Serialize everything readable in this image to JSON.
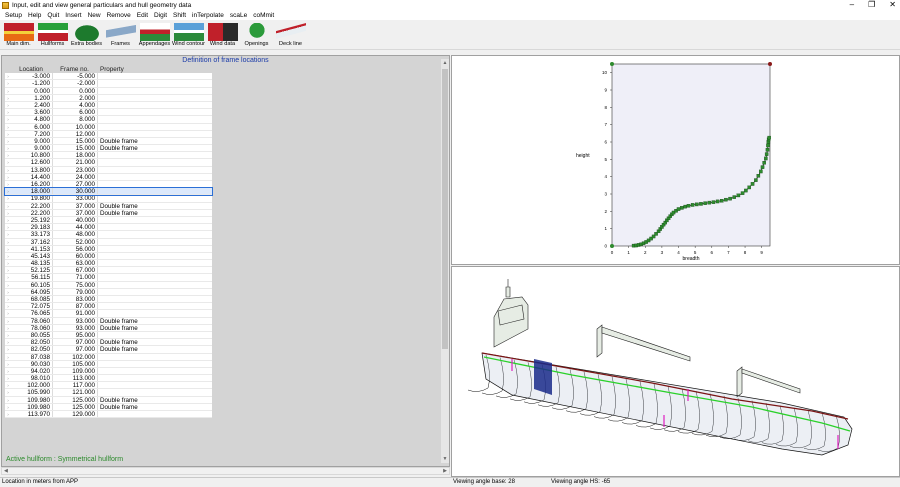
{
  "window": {
    "title": "Input, edit and view general particulars and hull geometry data",
    "minimize": "–",
    "restore": "❐",
    "close": "✕"
  },
  "menu": [
    "Setup",
    "Help",
    "Quit",
    "Insert",
    "New",
    "Remove",
    "Edit",
    "Digit",
    "Shift",
    "inTerpolate",
    "scaLe",
    "coMmit"
  ],
  "toolbar": [
    {
      "label": "Main dim.",
      "icon": "main-dimensions-icon"
    },
    {
      "label": "Hullforms",
      "icon": "hullforms-icon"
    },
    {
      "label": "Extra bodies",
      "icon": "extra-bodies-icon"
    },
    {
      "label": "Frames",
      "icon": "frames-icon"
    },
    {
      "label": "Appendages",
      "icon": "appendages-icon"
    },
    {
      "label": "Wind contour",
      "icon": "wind-contour-icon"
    },
    {
      "label": "Wind data",
      "icon": "wind-data-icon"
    },
    {
      "label": "Openings",
      "icon": "openings-icon"
    },
    {
      "label": "Deck line",
      "icon": "deck-line-icon"
    }
  ],
  "frames_panel": {
    "title": "Definition of frame locations",
    "columns": [
      "Location",
      "Frame no.",
      "Property"
    ],
    "rows": [
      [
        "-3.000",
        "-5.000",
        ""
      ],
      [
        "-1.200",
        "-2.000",
        ""
      ],
      [
        "0.000",
        "0.000",
        ""
      ],
      [
        "1.200",
        "2.000",
        ""
      ],
      [
        "2.400",
        "4.000",
        ""
      ],
      [
        "3.600",
        "6.000",
        ""
      ],
      [
        "4.800",
        "8.000",
        ""
      ],
      [
        "6.000",
        "10.000",
        ""
      ],
      [
        "7.200",
        "12.000",
        ""
      ],
      [
        "9.000",
        "15.000",
        "Double frame"
      ],
      [
        "9.000",
        "15.000",
        "Double frame"
      ],
      [
        "10.800",
        "18.000",
        ""
      ],
      [
        "12.600",
        "21.000",
        ""
      ],
      [
        "13.800",
        "23.000",
        ""
      ],
      [
        "14.400",
        "24.000",
        ""
      ],
      [
        "16.200",
        "27.000",
        ""
      ],
      [
        "18.000",
        "30.000",
        ""
      ],
      [
        "19.800",
        "33.000",
        ""
      ],
      [
        "22.200",
        "37.000",
        "Double frame"
      ],
      [
        "22.200",
        "37.000",
        "Double frame"
      ],
      [
        "25.192",
        "40.000",
        ""
      ],
      [
        "29.183",
        "44.000",
        ""
      ],
      [
        "33.173",
        "48.000",
        ""
      ],
      [
        "37.162",
        "52.000",
        ""
      ],
      [
        "41.153",
        "56.000",
        ""
      ],
      [
        "45.143",
        "60.000",
        ""
      ],
      [
        "48.135",
        "63.000",
        ""
      ],
      [
        "52.125",
        "67.000",
        ""
      ],
      [
        "56.115",
        "71.000",
        ""
      ],
      [
        "60.105",
        "75.000",
        ""
      ],
      [
        "64.095",
        "79.000",
        ""
      ],
      [
        "68.085",
        "83.000",
        ""
      ],
      [
        "72.075",
        "87.000",
        ""
      ],
      [
        "76.065",
        "91.000",
        ""
      ],
      [
        "78.060",
        "93.000",
        "Double frame"
      ],
      [
        "78.060",
        "93.000",
        "Double frame"
      ],
      [
        "80.055",
        "95.000",
        ""
      ],
      [
        "82.050",
        "97.000",
        "Double frame"
      ],
      [
        "82.050",
        "97.000",
        "Double frame"
      ],
      [
        "87.038",
        "102.000",
        ""
      ],
      [
        "90.030",
        "105.000",
        ""
      ],
      [
        "94.020",
        "109.000",
        ""
      ],
      [
        "98.010",
        "113.000",
        ""
      ],
      [
        "102.000",
        "117.000",
        ""
      ],
      [
        "105.990",
        "121.000",
        ""
      ],
      [
        "109.980",
        "125.000",
        "Double frame"
      ],
      [
        "109.980",
        "125.000",
        "Double frame"
      ],
      [
        "113.970",
        "129.000",
        ""
      ]
    ],
    "selected_row": 16,
    "status": "Active hullform : Symmetrical hullform"
  },
  "status": {
    "left": "Location in meters from APP",
    "mid": "Viewing angle base: 28",
    "right": "Viewing angle HS: -65"
  },
  "chart_data": {
    "type": "scatter",
    "xlabel": "breadth",
    "ylabel": "height",
    "xlim": [
      0,
      9.5
    ],
    "ylim": [
      0,
      10.5
    ],
    "x_ticks": [
      "0",
      "1",
      "2",
      "3",
      "4",
      "5",
      "6",
      "7",
      "8",
      "9"
    ],
    "y_ticks": [
      "0",
      "1",
      "2",
      "3",
      "4",
      "5",
      "6",
      "7",
      "8",
      "9",
      "10"
    ],
    "x": [
      1.3,
      1.45,
      1.6,
      1.75,
      1.9,
      2.05,
      2.2,
      2.35,
      2.5,
      2.65,
      2.8,
      2.9,
      3.0,
      3.1,
      3.2,
      3.3,
      3.4,
      3.5,
      3.6,
      3.7,
      3.85,
      4.0,
      4.2,
      4.4,
      4.6,
      4.85,
      5.1,
      5.35,
      5.6,
      5.85,
      6.1,
      6.35,
      6.6,
      6.85,
      7.1,
      7.35,
      7.6,
      7.85,
      8.05,
      8.25,
      8.45,
      8.65,
      8.8,
      8.95,
      9.05,
      9.15,
      9.25,
      9.3,
      9.35,
      9.38,
      9.4,
      9.42,
      9.45
    ],
    "y": [
      0.02,
      0.03,
      0.06,
      0.1,
      0.16,
      0.23,
      0.32,
      0.43,
      0.55,
      0.7,
      0.85,
      0.98,
      1.1,
      1.23,
      1.35,
      1.48,
      1.6,
      1.72,
      1.83,
      1.93,
      2.03,
      2.13,
      2.2,
      2.27,
      2.32,
      2.37,
      2.4,
      2.43,
      2.47,
      2.5,
      2.53,
      2.57,
      2.61,
      2.67,
      2.73,
      2.82,
      2.92,
      3.05,
      3.2,
      3.38,
      3.58,
      3.8,
      4.05,
      4.3,
      4.55,
      4.8,
      5.05,
      5.3,
      5.55,
      5.8,
      6.0,
      6.15,
      6.25
    ],
    "extra_points": [
      {
        "x": 0,
        "y": 0
      },
      {
        "x": 0,
        "y": 10.5
      },
      {
        "x": 9.5,
        "y": 10.5
      }
    ],
    "grid": false
  }
}
